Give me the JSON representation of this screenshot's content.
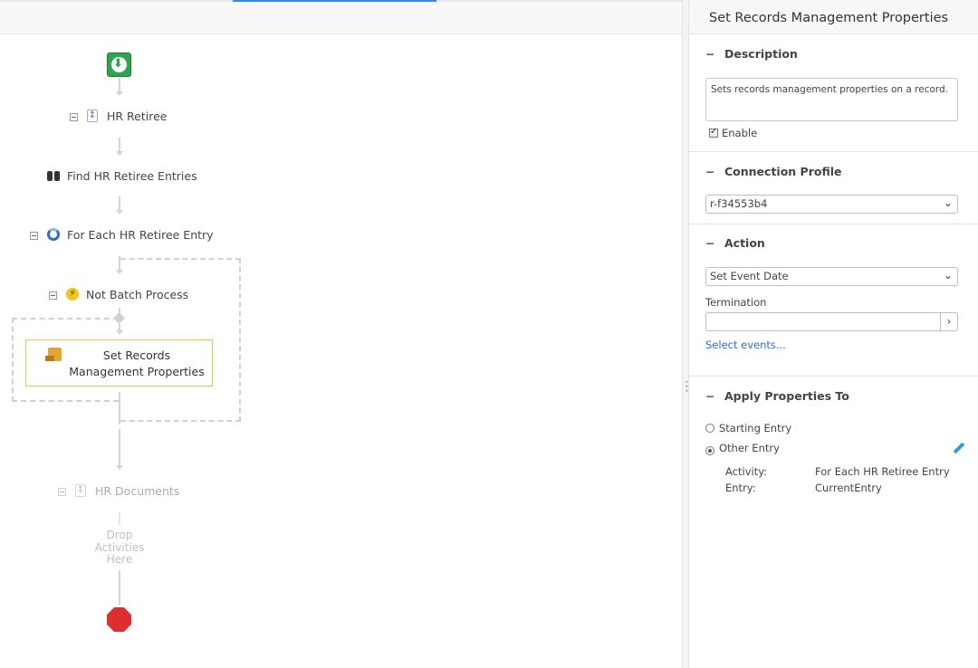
{
  "canvas": {
    "nodes": {
      "hr_retiree": "HR Retiree",
      "find_entries": "Find HR Retiree Entries",
      "for_each": "For Each HR Retiree Entry",
      "not_batch": "Not Batch Process",
      "set_rm_props": "Set Records Management Properties",
      "hr_documents": "HR Documents",
      "drop_here": "Drop Activities Here"
    }
  },
  "panel": {
    "title": "Set Records Management Properties",
    "description": {
      "heading": "Description",
      "value": "Sets records management properties on a record.",
      "enable_label": "Enable",
      "enabled": true
    },
    "connection_profile": {
      "heading": "Connection Profile",
      "selected": "r-f34553b4"
    },
    "action": {
      "heading": "Action",
      "selected": "Set Event Date",
      "termination_label": "Termination",
      "termination_value": "",
      "select_events_link": "Select events..."
    },
    "apply_to": {
      "heading": "Apply Properties To",
      "option_starting": "Starting Entry",
      "option_other": "Other Entry",
      "selected": "Other Entry",
      "activity_label": "Activity:",
      "activity_value": "For Each HR Retiree Entry",
      "entry_label": "Entry:",
      "entry_value": "CurrentEntry"
    }
  },
  "colors": {
    "accent": "#2d8ceb",
    "selection_border": "#e8c24a",
    "start_green": "#2ea44f",
    "stop_red": "#e02e2e",
    "link": "#2d6bd6"
  },
  "icons": {
    "start": "start-icon",
    "stop": "stop-icon",
    "scope": "scope-icon",
    "find": "binoculars-icon",
    "loop": "loop-icon",
    "condition": "condition-icon",
    "records": "records-management-icon",
    "edit": "pencil-icon"
  }
}
